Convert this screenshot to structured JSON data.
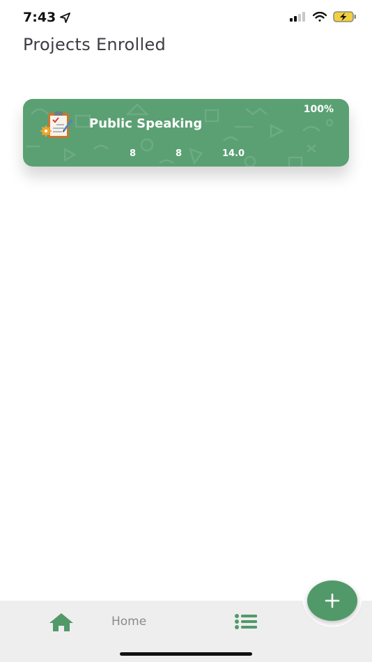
{
  "status_bar": {
    "time": "7:43",
    "icons": [
      "location-arrow-icon",
      "cellular-signal-icon",
      "wifi-icon",
      "battery-charging-icon"
    ]
  },
  "page": {
    "title": "Projects Enrolled"
  },
  "projects": [
    {
      "title": "Public Speaking",
      "progress": "100%",
      "icon": "clipboard-gear-pencil-icon",
      "stats": [
        "8",
        "8",
        "14.0"
      ],
      "color": "#5aa073"
    }
  ],
  "bottom_nav": {
    "home_label": "Home",
    "items": [
      "home-icon",
      "list-icon"
    ],
    "fab": "plus-icon",
    "accent_color": "#52996a"
  }
}
